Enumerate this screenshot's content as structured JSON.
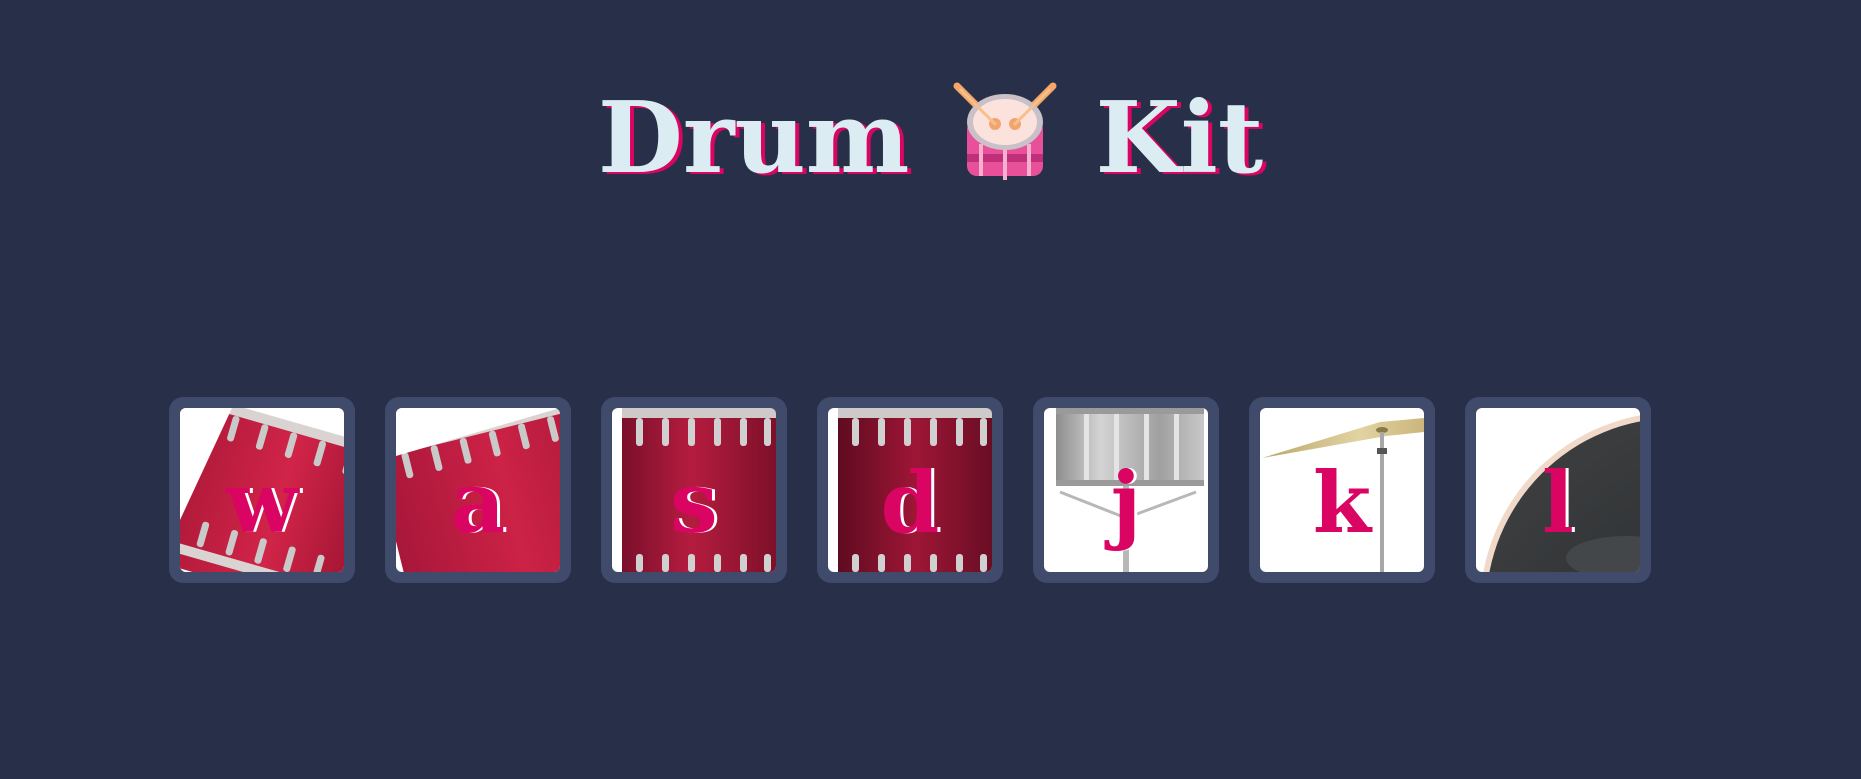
{
  "header": {
    "title_left": "Drum",
    "title_emoji": "drum-with-drumsticks-icon",
    "title_right": "Kit"
  },
  "colors": {
    "background": "#283049",
    "tile_border": "#404b6c",
    "title_text": "#dbedf3",
    "accent": "#da0463"
  },
  "drums": [
    {
      "key": "w",
      "image": "tom-1-drum"
    },
    {
      "key": "a",
      "image": "tom-2-drum"
    },
    {
      "key": "s",
      "image": "tom-3-drum"
    },
    {
      "key": "d",
      "image": "tom-4-drum"
    },
    {
      "key": "j",
      "image": "snare-drum"
    },
    {
      "key": "k",
      "image": "crash-cymbal"
    },
    {
      "key": "l",
      "image": "kick-drum"
    }
  ]
}
